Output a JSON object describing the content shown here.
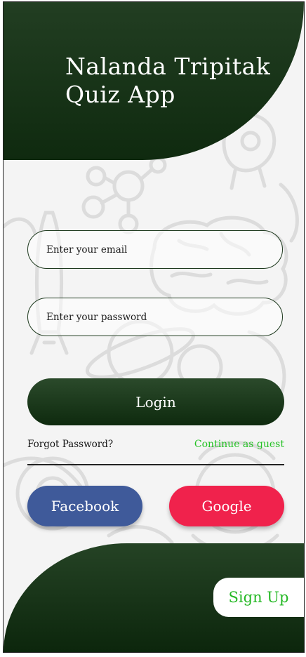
{
  "app": {
    "title_line1": "Nalanda Tripitak",
    "title_line2": "Quiz App"
  },
  "form": {
    "email_placeholder": "Enter your email",
    "password_placeholder": "Enter your password",
    "login_label": "Login",
    "forgot_label": "Forgot Password?",
    "guest_label": "Continue as guest"
  },
  "social": {
    "facebook_label": "Facebook",
    "google_label": "Google"
  },
  "footer": {
    "signup_label": "Sign Up"
  },
  "colors": {
    "primary_green": "#1f3a1f",
    "accent_green": "#25c225",
    "facebook_blue": "#3f5a9a",
    "google_red": "#f0224c"
  }
}
